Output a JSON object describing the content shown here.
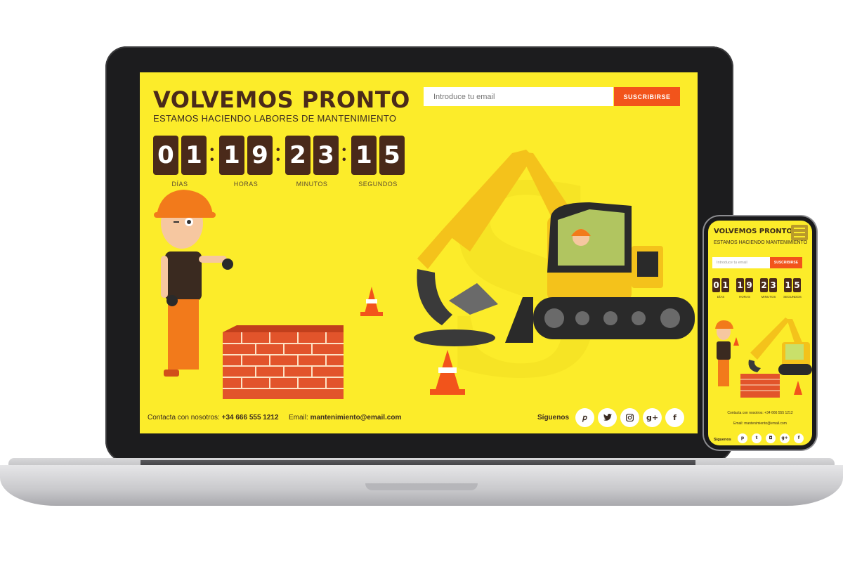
{
  "laptop": {
    "title": "VOLVEMOS PRONTO",
    "subtitle": "ESTAMOS HACIENDO LABORES DE MANTENIMIENTO",
    "email_placeholder": "Introduce tu email",
    "subscribe_label": "SUSCRIBIRSE",
    "countdown": {
      "dias": [
        "0",
        "1"
      ],
      "horas": [
        "1",
        "9"
      ],
      "minutos": [
        "2",
        "3"
      ],
      "segundos": [
        "1",
        "5"
      ],
      "labels": {
        "dias": "DÍAS",
        "horas": "HORAS",
        "minutos": "MINUTOS",
        "segundos": "SEGUNDOS"
      }
    },
    "footer": {
      "contact_prefix": "Contacta con nosotros: ",
      "phone": "+34 666 555 1212",
      "email_prefix": "Email: ",
      "email": "mantenimiento@email.com",
      "follow_label": "Síguenos"
    },
    "social_icons": [
      {
        "name": "pinterest-icon",
        "glyph": "𝑝"
      },
      {
        "name": "twitter-icon",
        "glyph": "🐦"
      },
      {
        "name": "instagram-icon",
        "glyph": "◘"
      },
      {
        "name": "google-plus-icon",
        "glyph": "g+"
      },
      {
        "name": "facebook-icon",
        "glyph": "f"
      }
    ]
  },
  "phone": {
    "title": "VOLVEMOS PRONTO",
    "subtitle": "ESTAMOS HACIENDO MANTENIMIENTO",
    "email_placeholder": "Introduce tu email",
    "subscribe_label": "SUSCRIBIRSE",
    "digits": [
      "0",
      "1",
      "1",
      "9",
      "2",
      "3",
      "1",
      "5"
    ],
    "labels": [
      "DÍAS",
      "HORAS",
      "MINUTOS",
      "SEGUNDOS"
    ],
    "contact_line": "Contacta con nosotros: +34 666 555 1212",
    "email_line": "Email: mantenimiento@email.com",
    "follow_label": "Síguenos"
  },
  "colors": {
    "background": "#fcec2a",
    "accent": "#f2541b",
    "digit_bg": "#4a2a1a",
    "laptop_body": "#1c1c1e"
  }
}
